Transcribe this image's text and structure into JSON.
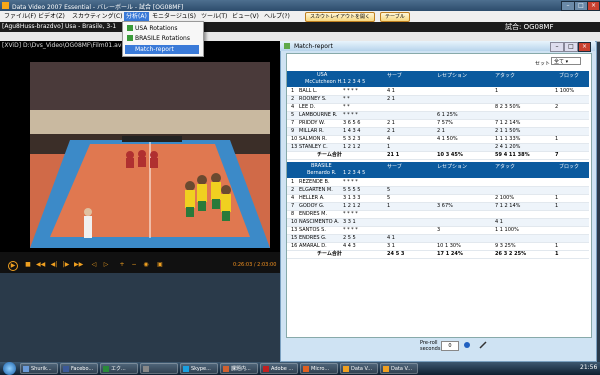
{
  "window": {
    "title": "Data Video 2007 Essential - バレーボール - 試合 [OG08MF]"
  },
  "menu": {
    "items": [
      "ファイル(F)",
      "ビデオ(Z)",
      "スカウティング(C)",
      "分析(A)",
      "モニタージュ(S)",
      "ツール(T)",
      "ビュー(V)",
      "ヘルプ(?)"
    ],
    "buttons": [
      "スカウトレイアウトを開く",
      "テーブル"
    ],
    "game_label": "試合: OG08MF"
  },
  "dropdown": {
    "items": [
      "USA Rotations",
      "BRASILE Rotations",
      "Match-report"
    ]
  },
  "infostrip": {
    "text": "[Agu8Huss-brazdvo] Usa - Brasile, 3-1"
  },
  "video": {
    "path": "[XViD] D:\\Dvs_Video\\OG08MF\\Film01.avi",
    "time": "0:26:03 / 2:03:00",
    "progress": 0.82
  },
  "report": {
    "title": "Match-report",
    "set_label": "セット",
    "set_value": "全て",
    "usa": {
      "team": "USA",
      "coach": "McCutcheon H.",
      "col_groups": [
        "サーブ",
        "レセプション",
        "アタック",
        "ブロック"
      ],
      "set_cols": "1 2 3 4 5",
      "players": [
        {
          "no": "1",
          "name": "BALL L.",
          "sets": "* * * *",
          "serve": "4 1",
          "rec": "",
          "att": "1",
          "blk": "1 100%"
        },
        {
          "no": "2",
          "name": "ROONEY S.",
          "sets": "* *",
          "serve": "2 1",
          "rec": "",
          "att": "",
          "blk": ""
        },
        {
          "no": "4",
          "name": "LEE D.",
          "sets": "* *",
          "serve": "",
          "rec": "",
          "att": "8 2 3 50%",
          "blk": "2"
        },
        {
          "no": "5",
          "name": "LAMBOURNE R.",
          "sets": "* * * *",
          "serve": "",
          "rec": "6 1 25%",
          "att": "",
          "blk": ""
        },
        {
          "no": "7",
          "name": "PRIDDY W.",
          "sets": "3 6 5 6",
          "serve": "2 1",
          "rec": "7 57%",
          "att": "7 1 2 14%",
          "blk": ""
        },
        {
          "no": "9",
          "name": "MILLAR R.",
          "sets": "1 4 3 4",
          "serve": "2 1",
          "rec": "2 1",
          "att": "2 1 1 50%",
          "blk": ""
        },
        {
          "no": "10",
          "name": "SALMON R.",
          "sets": "5 3 2 3",
          "serve": "4",
          "rec": "4 1 50%",
          "att": "1 1 1 33%",
          "blk": "1"
        },
        {
          "no": "13",
          "name": "STANLEY C.",
          "sets": "1 2 1 2",
          "serve": "1",
          "rec": "",
          "att": "2 4 1 20%",
          "blk": ""
        }
      ],
      "total": {
        "label": "チーム合計",
        "serve": "21 1",
        "rec": "10 3 45%",
        "att": "59 4 11 38%",
        "blk": "7"
      }
    },
    "brasile": {
      "team": "BRASILE",
      "coach": "Bernardo R.",
      "col_groups": [
        "サーブ",
        "レセプション",
        "アタック",
        "ブロック"
      ],
      "set_cols": "1 2 3 4 5",
      "players": [
        {
          "no": "1",
          "name": "REZENDE B.",
          "sets": "* * * *",
          "serve": "",
          "rec": "",
          "att": "",
          "blk": ""
        },
        {
          "no": "2",
          "name": "ELGARTEN M.",
          "sets": "5 5 5 5",
          "serve": "5",
          "rec": "",
          "att": "",
          "blk": ""
        },
        {
          "no": "4",
          "name": "HELLER A.",
          "sets": "3 1 3 3",
          "serve": "5",
          "rec": "",
          "att": "2 100%",
          "blk": "1"
        },
        {
          "no": "7",
          "name": "GODOY G.",
          "sets": "1 2 1 2",
          "serve": "1",
          "rec": "3 67%",
          "att": "7 1 2 14%",
          "blk": "1"
        },
        {
          "no": "8",
          "name": "ENDRES M.",
          "sets": "* * * *",
          "serve": "",
          "rec": "",
          "att": "",
          "blk": ""
        },
        {
          "no": "10",
          "name": "NASCIMENTO A.",
          "sets": "3 3 1",
          "serve": "",
          "rec": "",
          "att": "4 1",
          "blk": ""
        },
        {
          "no": "13",
          "name": "SANTOS S.",
          "sets": "* * * *",
          "serve": "",
          "rec": "3",
          "att": "1 1 100%",
          "blk": ""
        },
        {
          "no": "15",
          "name": "ENDRES G.",
          "sets": "2 5 5",
          "serve": "4 1",
          "rec": "",
          "att": "",
          "blk": ""
        },
        {
          "no": "16",
          "name": "AMARAL D.",
          "sets": "4 4 3",
          "serve": "3 1",
          "rec": "10 1 30%",
          "att": "9 3 25%",
          "blk": "1"
        }
      ],
      "total": {
        "label": "チーム合計",
        "serve": "24 5 3",
        "rec": "17 1 24%",
        "att": "26 3 2 25%",
        "blk": "1"
      }
    },
    "footer": {
      "prev_label": "Pre-roll seconds",
      "prev_value": "0"
    }
  },
  "taskbar": {
    "items": [
      "Shurik...",
      "Facebo...",
      "エク...",
      "",
      "Skype...",
      "課題内...",
      "Adobe ...",
      "Micro...",
      "Data V...",
      "Data V..."
    ],
    "clock": "21:56"
  },
  "colors": {
    "accent": "#3a7ad8",
    "table_header": "#0b5a9e",
    "video_accent": "#f09020"
  }
}
